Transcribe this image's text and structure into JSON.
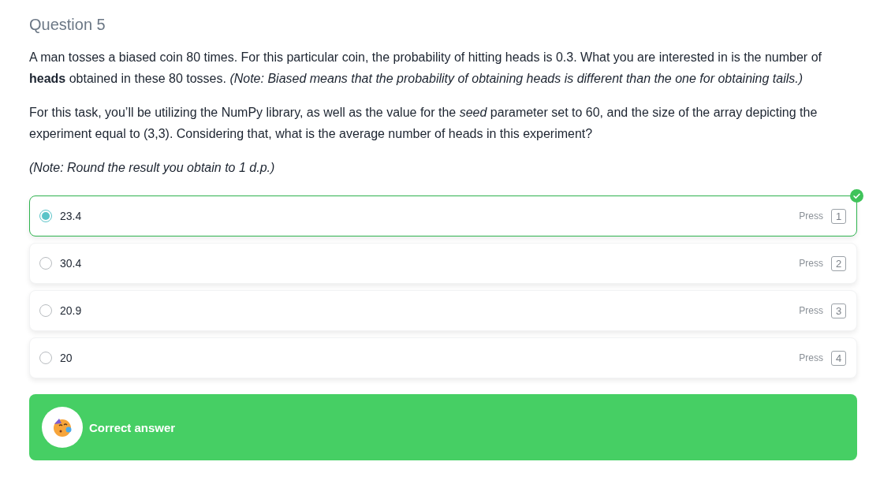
{
  "question": {
    "title": "Question 5",
    "paragraphs": [
      "A man tosses a biased coin 80 times. For this particular coin, the probability of hitting heads is 0.3. What you are interested in is the number of **heads** obtained in these 80 tosses. *(Note: Biased means that the probability of obtaining heads is different than the one for obtaining tails.)*",
      "For this task, you’ll be utilizing the NumPy library, as well as the value for the *seed* parameter set to 60, and the size of the array depicting the experiment equal to (3,3). Considering that, what is the average number of heads in this experiment?",
      "*(Note: Round the result you obtain to 1 d.p.)*"
    ]
  },
  "options": [
    {
      "label": "23.4",
      "selected": true,
      "correct": true,
      "hint": "Press",
      "key": "1"
    },
    {
      "label": "30.4",
      "selected": false,
      "correct": false,
      "hint": "Press",
      "key": "2"
    },
    {
      "label": "20.9",
      "selected": false,
      "correct": false,
      "hint": "Press",
      "key": "3"
    },
    {
      "label": "20",
      "selected": false,
      "correct": false,
      "hint": "Press",
      "key": "4"
    }
  ],
  "feedback": {
    "kind": "correct",
    "message": "Correct answer"
  }
}
